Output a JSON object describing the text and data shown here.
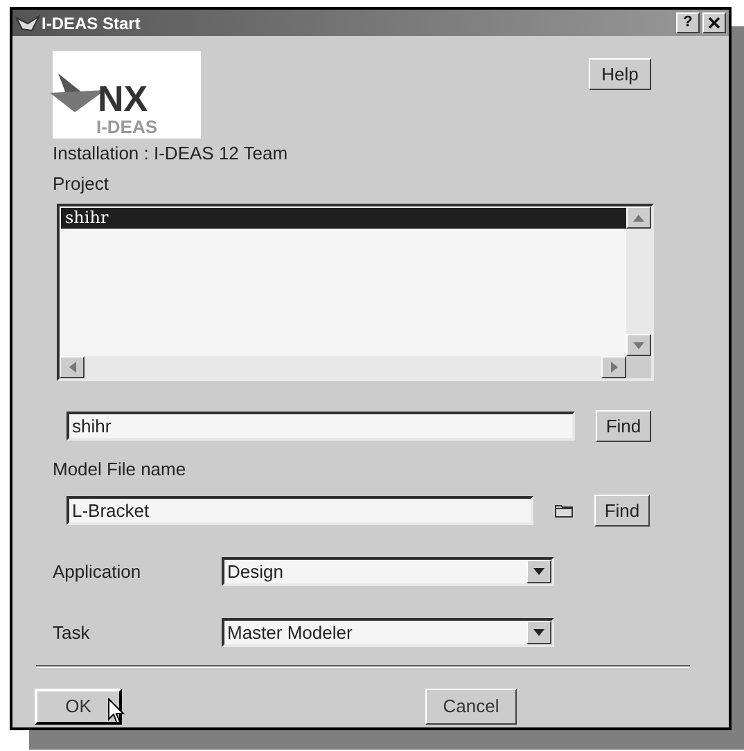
{
  "window": {
    "title": "I-DEAS Start",
    "help_glyph": "?"
  },
  "logo": {
    "title": "NX",
    "subtitle": "I-DEAS"
  },
  "help_button": "Help",
  "installation": "Installation : I-DEAS 12 Team",
  "project": {
    "label": "Project",
    "items": [
      {
        "text": "shihr",
        "selected": true
      }
    ],
    "value": "shihr",
    "find": "Find"
  },
  "model_file": {
    "label": "Model File name",
    "value": "L-Bracket",
    "find": "Find"
  },
  "application": {
    "label": "Application",
    "value": "Design"
  },
  "task": {
    "label": "Task",
    "value": "Master Modeler"
  },
  "buttons": [
    {
      "label": "OK",
      "focused": true
    },
    {
      "label": "Cancel",
      "focused": false
    }
  ]
}
